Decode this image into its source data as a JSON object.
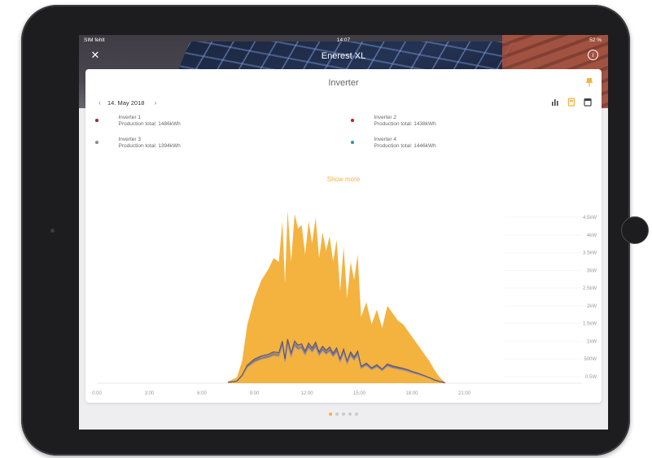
{
  "status_bar": {
    "carrier": "SIM fehlt",
    "time": "14:07",
    "battery": "52 %"
  },
  "nav": {
    "title": "Enerest XL"
  },
  "card": {
    "title": "Inverter",
    "date": "14. May 2018",
    "show_more": "Show more"
  },
  "legend": [
    {
      "name": "Inverter 1",
      "detail": "Production total: 1486kWh",
      "color": "#8a2f4a"
    },
    {
      "name": "Inverter 2",
      "detail": "Production total: 1438kWh",
      "color": "#c8202a"
    },
    {
      "name": "Inverter 3",
      "detail": "Production total: 1394kWh",
      "color": "#8d8d93"
    },
    {
      "name": "Inverter 4",
      "detail": "Production total: 1446kWh",
      "color": "#2f9aa6"
    }
  ],
  "colors": {
    "accent": "#f4b23f",
    "line": "#6e6478"
  },
  "pager": {
    "count": 5,
    "active": 0
  },
  "chart_data": {
    "type": "area",
    "x_tick_labels": [
      "0:00",
      "3:00",
      "6:00",
      "9:00",
      "12:00",
      "15:00",
      "18:00",
      "21:00"
    ],
    "y_tick_labels": [
      "4.5kW",
      "4kW",
      "3.5kW",
      "3kW",
      "2.5kW",
      "2kW",
      "1.5kW",
      "1kW",
      "500W",
      "0.5W"
    ],
    "x_unit": "hour",
    "x_range": [
      0,
      24
    ],
    "y_range": [
      0,
      5
    ],
    "series": [
      {
        "x": [
          7.5,
          8.0,
          8.3,
          8.6,
          9.0,
          9.4,
          9.8,
          10.1,
          10.4,
          10.6,
          10.75,
          10.9,
          11.1,
          11.3,
          11.5,
          11.7,
          11.9,
          12.1,
          12.3,
          12.5,
          12.7,
          12.9,
          13.1,
          13.3,
          13.5,
          13.7,
          13.9,
          14.1,
          14.3,
          14.5,
          14.7,
          14.9,
          15.1,
          15.4,
          15.7,
          16.0,
          16.3,
          16.6,
          16.9,
          17.2,
          17.5,
          17.8,
          18.1,
          18.4,
          18.7,
          19.0,
          19.3,
          19.6,
          19.9
        ],
        "y": [
          0.05,
          0.15,
          0.6,
          1.6,
          2.3,
          2.8,
          3.1,
          3.4,
          3.3,
          4.4,
          2.7,
          4.7,
          3.3,
          4.6,
          4.2,
          4.3,
          3.5,
          4.4,
          3.8,
          4.5,
          3.4,
          4.1,
          3.6,
          4.0,
          3.3,
          3.9,
          2.5,
          3.7,
          2.3,
          3.3,
          2.8,
          3.5,
          1.8,
          2.2,
          1.6,
          2.0,
          1.5,
          2.1,
          1.9,
          1.7,
          1.6,
          1.4,
          1.2,
          1.0,
          0.8,
          0.6,
          0.35,
          0.15,
          0.02
        ]
      },
      {
        "x": [
          7.5,
          8.0,
          8.3,
          8.6,
          9.0,
          9.4,
          9.8,
          10.1,
          10.4,
          10.6,
          10.75,
          10.9,
          11.1,
          11.3,
          11.5,
          11.7,
          11.9,
          12.1,
          12.3,
          12.5,
          12.7,
          12.9,
          13.1,
          13.3,
          13.5,
          13.7,
          13.9,
          14.1,
          14.3,
          14.5,
          14.7,
          14.9,
          15.1,
          15.4,
          15.7,
          16.0,
          16.3,
          16.6,
          16.9,
          17.2,
          17.5,
          17.8,
          18.1,
          18.4,
          18.7,
          19.0,
          19.3,
          19.6,
          19.9
        ],
        "y": [
          0.02,
          0.05,
          0.2,
          0.45,
          0.6,
          0.68,
          0.72,
          0.78,
          0.76,
          1.05,
          0.6,
          1.1,
          0.75,
          1.05,
          0.95,
          0.98,
          0.8,
          1.0,
          0.88,
          1.02,
          0.78,
          0.92,
          0.82,
          0.9,
          0.75,
          0.88,
          0.6,
          0.85,
          0.55,
          0.78,
          0.65,
          0.8,
          0.42,
          0.5,
          0.38,
          0.46,
          0.35,
          0.48,
          0.43,
          0.4,
          0.37,
          0.33,
          0.28,
          0.24,
          0.19,
          0.14,
          0.08,
          0.04,
          0.01
        ]
      }
    ]
  }
}
